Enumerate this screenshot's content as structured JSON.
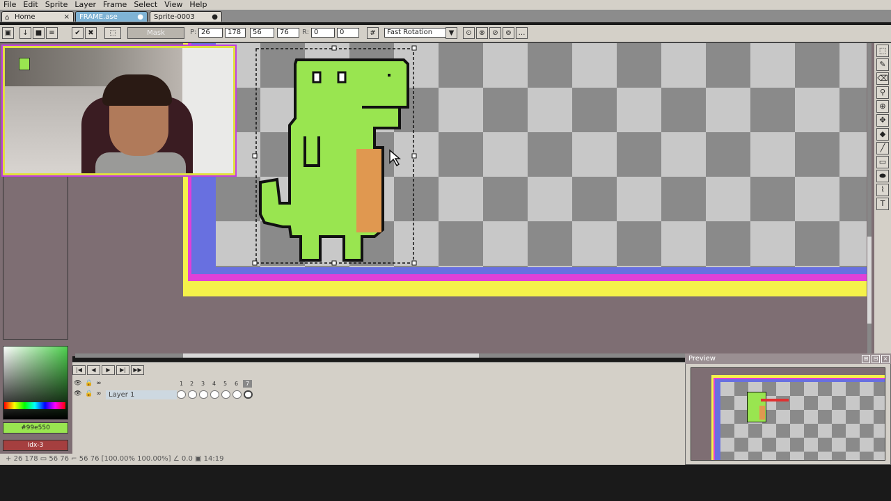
{
  "menu": [
    "File",
    "Edit",
    "Sprite",
    "Layer",
    "Frame",
    "Select",
    "View",
    "Help"
  ],
  "tabs": [
    {
      "label": "Home",
      "icon": "home-icon",
      "close": "×"
    },
    {
      "label": "FRAME.ase",
      "close": "●"
    },
    {
      "label": "Sprite-0003",
      "close": "●"
    }
  ],
  "toolbar": {
    "mask_label": "Mask",
    "pos_label": "P:",
    "x": "26",
    "y": "178",
    "w": "56",
    "h": "76",
    "rot_label": "R:",
    "rot_a": "0",
    "rot_b": "0",
    "rotation_mode": "Fast Rotation"
  },
  "colors": {
    "fg_hex": "#99e550",
    "bg_label": "Idx-3",
    "accent_green": "#99e550",
    "orange": "#e09850",
    "frame_yellow": "#f5f24a",
    "frame_magenta": "#e040d8",
    "frame_purple": "#6870e0"
  },
  "timeline": {
    "frames": [
      "1",
      "2",
      "3",
      "4",
      "5",
      "6",
      "7"
    ],
    "layer_name": "Layer 1"
  },
  "preview": {
    "title": "Preview"
  },
  "status": {
    "pos": "26 178",
    "size": "56 76",
    "sel": "56 76 [100.00% 100.00%]",
    "angle": "0.0",
    "frame": "14:19"
  }
}
